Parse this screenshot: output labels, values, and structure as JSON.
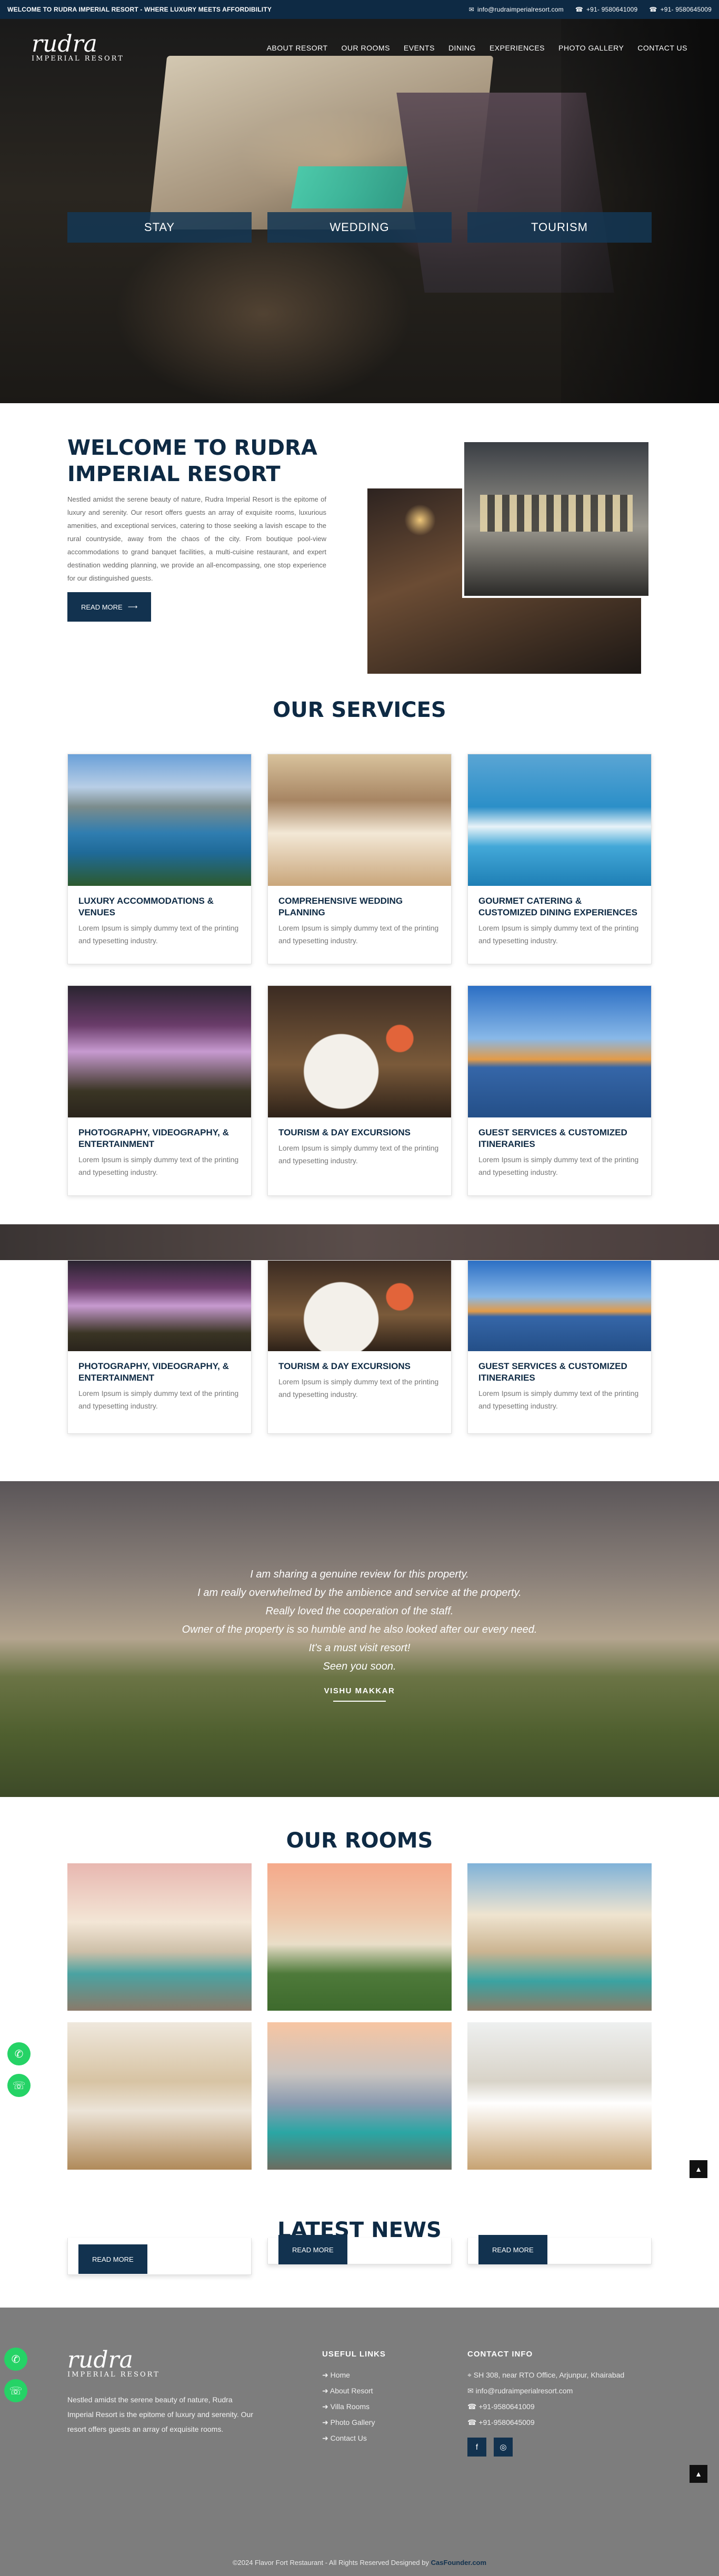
{
  "topbar": {
    "welcome": "WELCOME TO RUDRA IMPERIAL RESORT - WHERE LUXURY MEETS AFFORDIBILITY",
    "email": "info@rudraimperialresort.com",
    "phone1": "+91- 9580641009",
    "phone2": "+91- 9580645009"
  },
  "logo": {
    "name": "rudra",
    "sub": "IMPERIAL RESORT"
  },
  "nav": [
    "ABOUT RESORT",
    "OUR ROOMS",
    "EVENTS",
    "DINING",
    "EXPERIENCES",
    "PHOTO GALLERY",
    "CONTACT US"
  ],
  "booking": [
    "STAY",
    "WEDDING",
    "TOURISM"
  ],
  "welcome": {
    "title": "WELCOME TO RUDRA IMPERIAL RESORT",
    "text": "Nestled amidst the serene beauty of nature, Rudra Imperial Resort is the epitome of luxury and serenity. Our resort offers guests an array of exquisite rooms, luxurious amenities, and exceptional services, catering to those seeking a lavish escape to the rural countryside, away from the chaos of the city. From boutique pool-view accommodations to grand banquet facilities, a multi-cuisine restaurant, and expert destination wedding planning, we provide an all-encompassing, one stop experience for our distinguished guests.",
    "button": "READ MORE"
  },
  "services": {
    "title": "OUR SERVICES",
    "items": [
      {
        "title": "LUXURY ACCOMMODATIONS & VENUES",
        "text": "Lorem Ipsum is simply dummy text of the printing and typesetting industry."
      },
      {
        "title": "COMPREHENSIVE WEDDING PLANNING",
        "text": "Lorem Ipsum is simply dummy text of the printing and typesetting industry."
      },
      {
        "title": "GOURMET CATERING & CUSTOMIZED DINING EXPERIENCES",
        "text": "Lorem Ipsum is simply dummy text of the printing and typesetting industry."
      },
      {
        "title": "PHOTOGRAPHY, VIDEOGRAPHY, & ENTERTAINMENT",
        "text": "Lorem Ipsum is simply dummy text of the printing and typesetting industry."
      },
      {
        "title": "TOURISM & DAY EXCURSIONS",
        "text": "Lorem Ipsum is simply dummy text of the printing and typesetting industry."
      },
      {
        "title": "GUEST SERVICES & CUSTOMIZED ITINERARIES",
        "text": "Lorem Ipsum is simply dummy text of the printing and typesetting industry."
      }
    ]
  },
  "testimonial": {
    "lines": [
      "I am sharing a genuine review for this property.",
      "I am really overwhelmed by the ambience and service at the property.",
      "Really loved the cooperation of the staff.",
      "Owner of the property is so humble and he also looked after our every need.",
      "It's a must visit resort!",
      "Seen you soon."
    ],
    "name": "VISHU MAKKAR"
  },
  "rooms": {
    "title": "OUR ROOMS"
  },
  "news": {
    "title": "LATEST NEWS",
    "button": "READ MORE"
  },
  "footer": {
    "about": "Nestled amidst the serene beauty of nature, Rudra Imperial Resort is the epitome of luxury and serenity. Our resort offers guests an array of exquisite rooms.",
    "links_title": "USEFUL LINKS",
    "links": [
      "Home",
      "About Resort",
      "Villa Rooms",
      "Photo Gallery",
      "Contact Us"
    ],
    "contact_title": "CONTACT INFO",
    "address": "SH 308, near RTO Office, Arjunpur, Khairabad",
    "email": "info@rudraimperialresort.com",
    "phone1": "+91-9580641009",
    "phone2": "+91-9580645009",
    "copyright_prefix": "©2024 Flavor Fort Restaurant - All Rights Reserved Designed by",
    "designer": "CasFounder.com"
  },
  "colors": {
    "navy": "#0e2a44",
    "footer": "#7d7d7d",
    "whatsapp": "#25d366"
  }
}
